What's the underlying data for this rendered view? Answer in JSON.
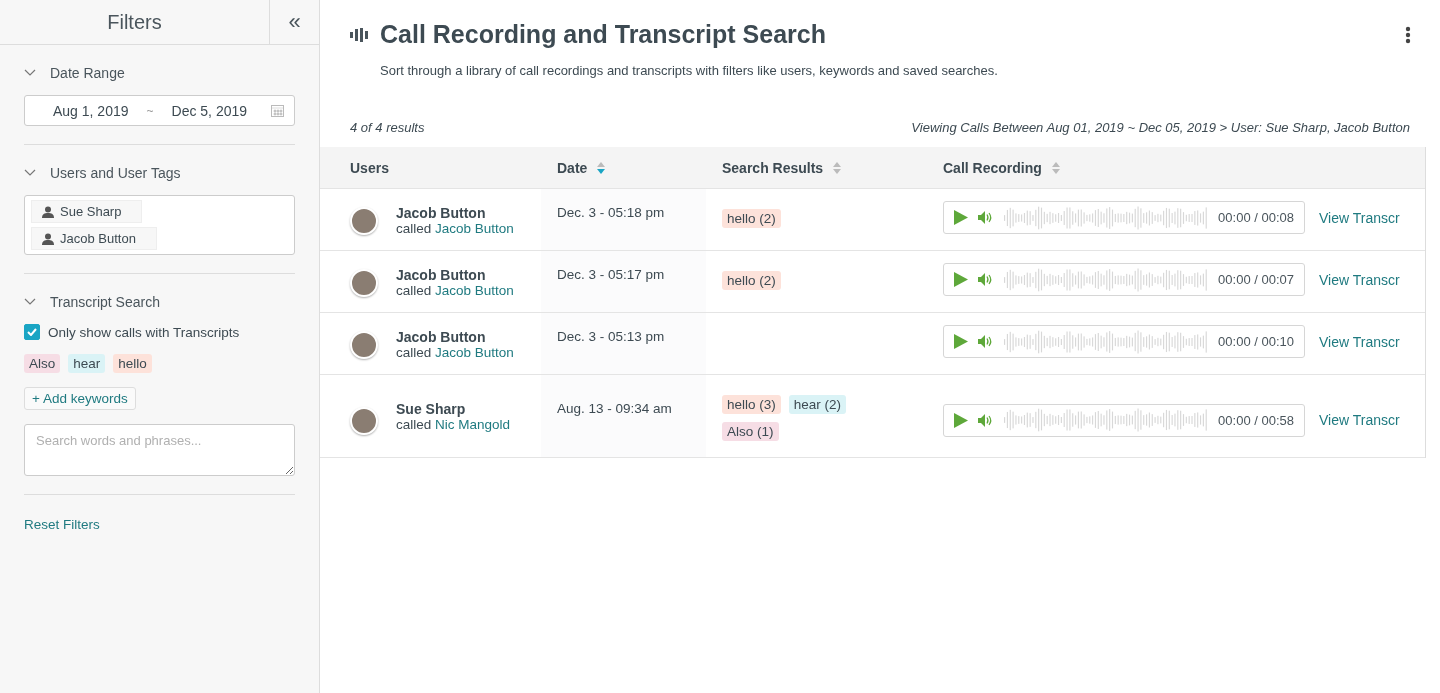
{
  "sidebar": {
    "title": "Filters",
    "collapse_label": "«",
    "sections": [
      {
        "kind": "dates",
        "title": "Date Range",
        "expanded": true,
        "start": "Aug 1, 2019",
        "separator": "~",
        "end": "Dec 5, 2019"
      },
      {
        "kind": "users",
        "title": "Users and User Tags",
        "expanded": true,
        "users": [
          "Sue Sharp",
          "Jacob Button"
        ]
      },
      {
        "kind": "transcript",
        "title": "Transcript Search",
        "expanded": true,
        "checkbox": {
          "label": "Only show calls with Transcripts",
          "checked": true
        },
        "keywords": [
          {
            "label": "Also",
            "color": "#f6dde5"
          },
          {
            "label": "hear",
            "color": "#daf3f6"
          },
          {
            "label": "hello",
            "color": "#fde2da"
          }
        ],
        "add_label": "+ Add keywords",
        "placeholder": "Search words and phrases..."
      }
    ],
    "reset_label": "Reset Filters"
  },
  "page": {
    "title": "Call Recording and Transcript Search",
    "description": "Sort through a library of call recordings and transcripts with filters like users, keywords and saved searches.",
    "result_count": "4 of 4 results",
    "breadcrumb": "Viewing Calls Between Aug 01, 2019 ~ Dec 05, 2019 > User: Sue Sharp, Jacob Button"
  },
  "table": {
    "columns": [
      {
        "label": "Users"
      },
      {
        "label": "Date",
        "sortable": true,
        "sorted": true
      },
      {
        "label": "Search Results",
        "sortable": true,
        "sorted": false
      },
      {
        "label": "Call Recording",
        "sortable": true,
        "sorted": false
      }
    ],
    "rows": [
      {
        "user": "Jacob Button",
        "called_prefix": "called",
        "called": "Jacob Button",
        "date": "Dec. 3 - 05:18 pm",
        "results": [
          {
            "label": "hello (2)",
            "color": "#fde2da"
          }
        ],
        "time": "00:00 / 00:08",
        "link": "View Transcr"
      },
      {
        "user": "Jacob Button",
        "called_prefix": "called",
        "called": "Jacob Button",
        "date": "Dec. 3 - 05:17 pm",
        "results": [
          {
            "label": "hello (2)",
            "color": "#fde2da"
          }
        ],
        "time": "00:00 / 00:07",
        "link": "View Transcr"
      },
      {
        "user": "Jacob Button",
        "called_prefix": "called",
        "called": "Jacob Button",
        "date": "Dec. 3 - 05:13 pm",
        "results": [],
        "time": "00:00 / 00:10",
        "link": "View Transcr"
      },
      {
        "user": "Sue Sharp",
        "called_prefix": "called",
        "called": "Nic Mangold",
        "date": "Aug. 13 - 09:34 am",
        "results": [
          {
            "label": "hello (3)",
            "color": "#fde2da"
          },
          {
            "label": "hear (2)",
            "color": "#daf3f6"
          },
          {
            "label": "Also (1)",
            "color": "#f6dde5"
          }
        ],
        "time": "00:00 / 00:58",
        "link": "View Transcr"
      }
    ]
  }
}
